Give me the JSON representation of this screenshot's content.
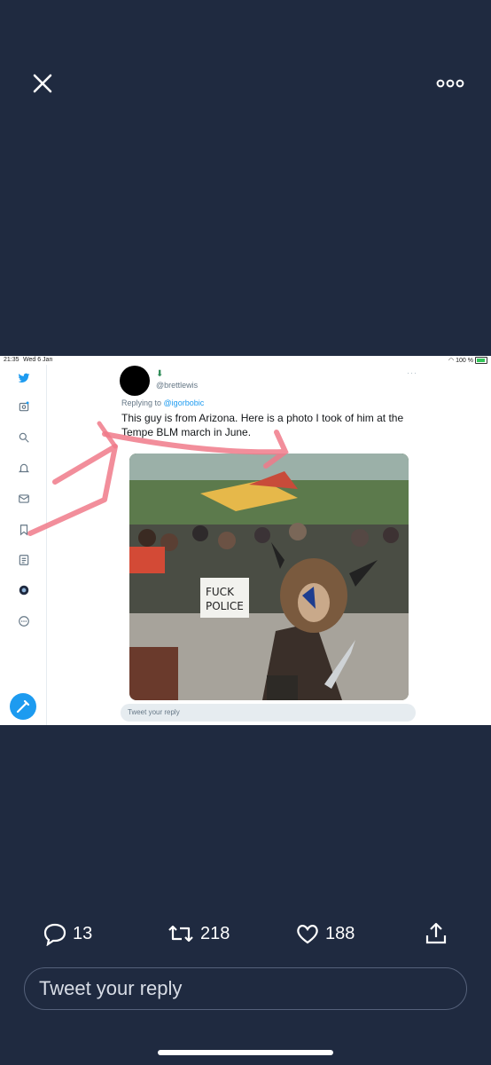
{
  "toolbar": {
    "close_icon": "close-icon",
    "more_icon": "more-icon"
  },
  "embedded": {
    "status_bar": {
      "time": "21:35",
      "date": "Wed 6 Jan",
      "battery": "100 %"
    },
    "tweet": {
      "handle": "@brettlewis",
      "replying_prefix": "Replying to",
      "replying_to": "@igorbobic",
      "text": "This guy is from Arizona. Here is a photo I took of him at the Tempe BLM march in June.",
      "more": "···"
    },
    "photo_sign_text": "FUCK POLICE",
    "reply_placeholder": "Tweet your reply",
    "annotation_color": "#f07a8a"
  },
  "actions": {
    "replies": "13",
    "retweets": "218",
    "likes": "188"
  },
  "reply_box": {
    "placeholder": "Tweet your reply"
  }
}
